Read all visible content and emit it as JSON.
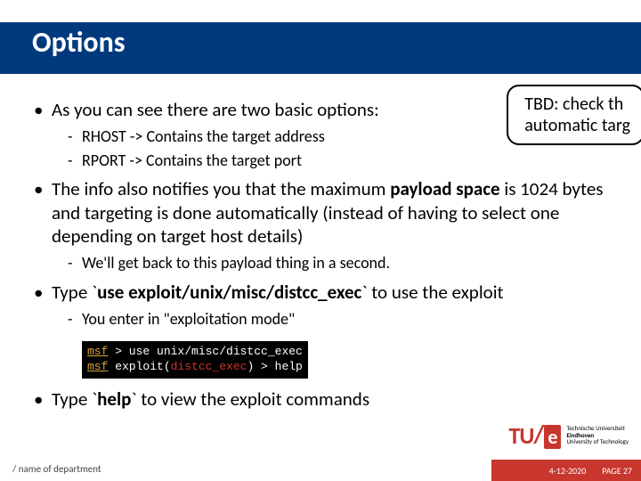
{
  "title": "Options",
  "callout": "TBD: check th\nautomatic targ",
  "bullets": {
    "b1": "As you can see there are two basic options:",
    "b1_sub1": "RHOST -> Contains the target address",
    "b1_sub2": "RPORT -> Contains the target port",
    "b2_pre": "The info also notifies you that the maximum ",
    "b2_bold": "payload space",
    "b2_post": " is 1024 bytes and targeting is done automatically (instead of having to select one depending on target host details)",
    "b2_sub1": "We'll get back to this payload thing in a second.",
    "b3_pre": "Type `",
    "b3_bold": "use exploit/unix/misc/distcc_exec",
    "b3_post": "` to use the exploit",
    "b3_sub1": "You enter in \"exploitation mode\"",
    "b4_pre": "Type `",
    "b4_bold": "help",
    "b4_post": "` to view the exploit commands"
  },
  "terminal": {
    "line1_a": "msf",
    "line1_b": " > use unix/misc/distcc_exec",
    "line2_a": "msf",
    "line2_b": " exploit(",
    "line2_c": "distcc_exec",
    "line2_d": ") > help"
  },
  "tue": {
    "mark": "TU",
    "e": "e",
    "text1": "Technische Universiteit",
    "text2_b": "Eindhoven",
    "text3": "University of Technology"
  },
  "footer": {
    "dept": "/ name of department",
    "date": "4-12-2020",
    "page": "PAGE 27"
  }
}
